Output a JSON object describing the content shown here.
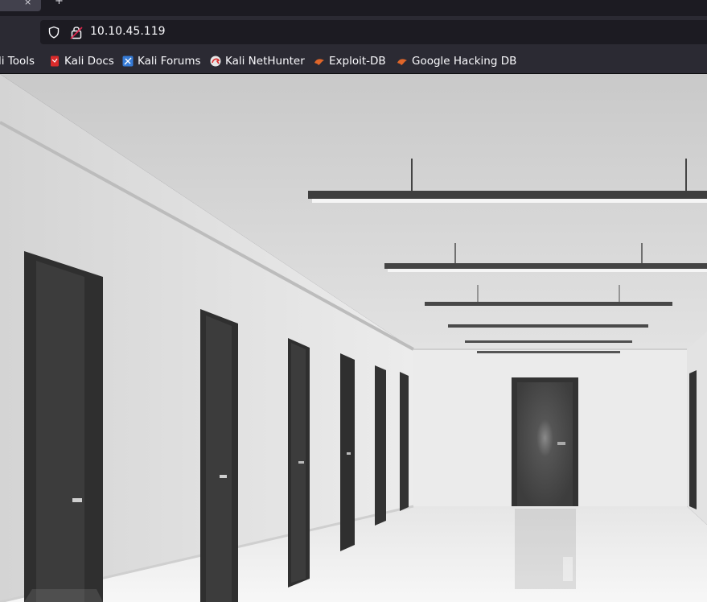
{
  "browser": {
    "tab": {
      "close_glyph": "×",
      "new_tab_glyph": "+"
    },
    "url": "10.10.45.119",
    "icons": {
      "shield": "shield-icon",
      "lock": "insecure-lock-icon"
    },
    "bookmarks": [
      {
        "label": "li Tools",
        "icon": "kali-icon"
      },
      {
        "label": "Kali Docs",
        "icon": "kali-docs-icon"
      },
      {
        "label": "Kali Forums",
        "icon": "kali-forums-icon"
      },
      {
        "label": "Kali NetHunter",
        "icon": "kali-nethunter-icon"
      },
      {
        "label": "Exploit-DB",
        "icon": "exploit-db-icon"
      },
      {
        "label": "Google Hacking DB",
        "icon": "ghdb-icon"
      }
    ]
  },
  "page": {
    "image": "corridor-with-doors-image"
  },
  "colors": {
    "toolbar": "#2b2a33",
    "urlbar": "#1c1b22",
    "text": "#fbfbfe",
    "kali_red": "#d92b2b",
    "exploit_orange": "#e0662a"
  }
}
